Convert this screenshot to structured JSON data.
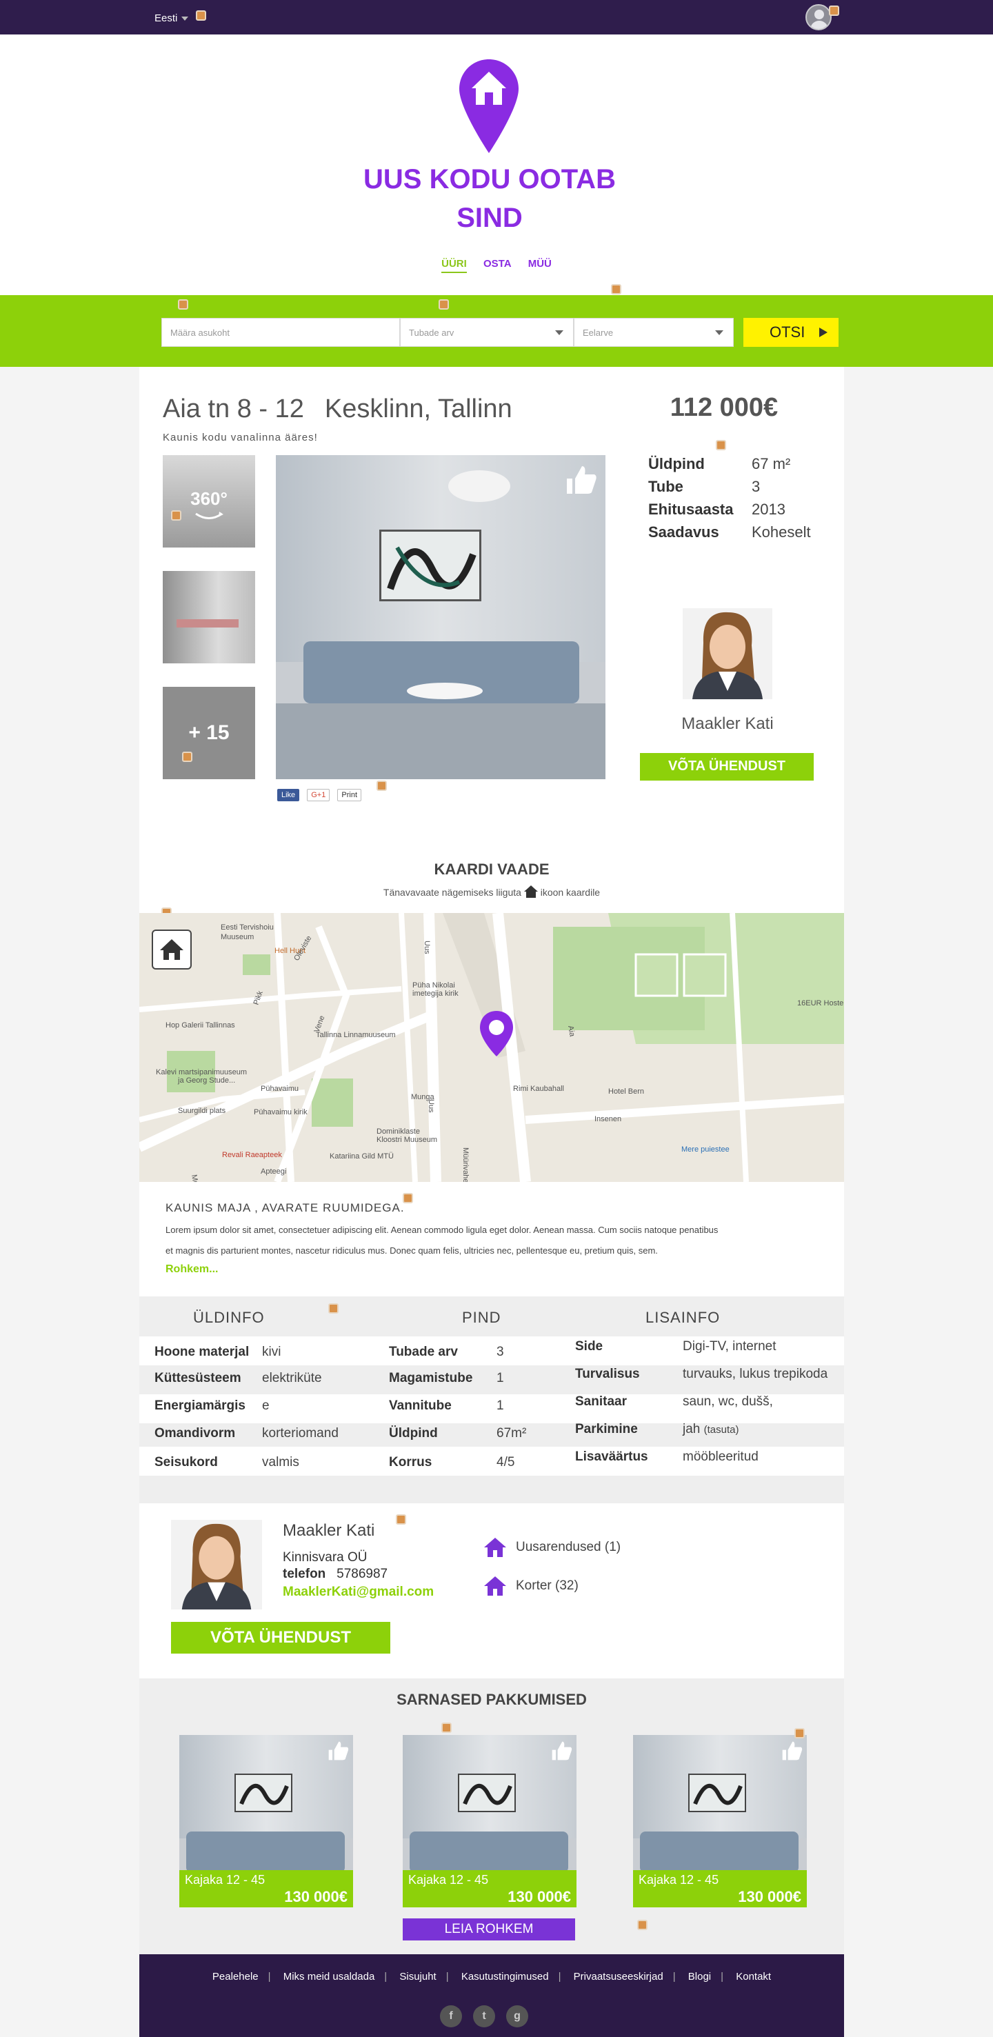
{
  "topbar": {
    "language": "Eesti"
  },
  "header": {
    "slogan_line1": "UUS KODU OOTAB",
    "slogan_line2": "SIND",
    "nav": [
      {
        "label": "ÜÜRI",
        "active": true
      },
      {
        "label": "OSTA"
      },
      {
        "label": "MÜÜ"
      }
    ]
  },
  "search": {
    "location_placeholder": "Määra asukoht",
    "rooms_placeholder": "Tubade arv",
    "budget_placeholder": "Eelarve",
    "submit_label": "OTSI"
  },
  "listing": {
    "street": "Aia tn 8 - 12",
    "district": "Kesklinn, Tallinn",
    "tagline": "Kaunis kodu vanalinna ääres!",
    "price": "112 000€",
    "thumb_360": "360°",
    "thumb_more": "+ 15",
    "social": {
      "like": "Like",
      "gplus": "G+1",
      "print": "Print"
    },
    "specs": [
      {
        "label": "Üldpind",
        "value": "67 m²"
      },
      {
        "label": "Tube",
        "value": "3"
      },
      {
        "label": "Ehitusaasta",
        "value": "2013"
      },
      {
        "label": "Saadavus",
        "value": "Koheselt"
      }
    ],
    "agent_name": "Maakler Kati",
    "contact_label": "VÕTA ÜHENDUST"
  },
  "map": {
    "title": "KAARDI VAADE",
    "subtitle_before": "Tänavavaate nägemiseks liiguta",
    "subtitle_after": "ikoon kaardile",
    "labels": {
      "museum1": "Eesti Tervishoiu",
      "museum1b": "Muuseum",
      "hellhunt": "Hell Hunt",
      "nikolai": "Püha Nikolai",
      "nikolai2": "imetegija kirik",
      "hop": "Hop Galerii Tallinnas",
      "linnamuuseum": "Tallinna Linnamuuseum",
      "kalevi": "Kalevi martsipanimuuseum",
      "kalevi2": "ja Georg Stude...",
      "suurgildi": "Suurgildi plats",
      "puhavaimu_kirik": "Pühavaimu kirik",
      "puhavaimu": "Pühavaimu",
      "munga": "Munga",
      "dominiklaste": "Dominiklaste",
      "dominiklaste2": "Kloostri Muuseum",
      "revali": "Revali Raeapteek",
      "katariina": "Katariina Gild MTÜ",
      "apteegi": "Apteegi",
      "rimi": "Rimi Kaubahall",
      "hotelbern": "Hotel Bern",
      "insenen": "Insenen",
      "mere": "Mere puiestee",
      "hostel": "16EUR Hostel",
      "viru": "Viru",
      "uus": "Uus",
      "aia": "Aia",
      "muurivahe": "Müürivahe",
      "vene": "Vene",
      "pikk": "Pikk",
      "oleviste": "Oleviste",
      "munkr": "Munk"
    }
  },
  "description": {
    "title": "KAUNIS MAJA , AVARATE RUUMIDEGA.",
    "line1": "Lorem ipsum dolor sit amet, consectetuer adipiscing elit. Aenean commodo ligula eget dolor. Aenean massa. Cum sociis natoque penatibus",
    "line2": "et magnis dis parturient montes, nascetur ridiculus mus. Donec quam felis, ultricies nec, pellentesque eu, pretium quis, sem.",
    "more_label": "Rohkem..."
  },
  "details": {
    "headers": [
      "ÜLDINFO",
      "PIND",
      "LISAINFO"
    ],
    "col1": [
      {
        "k": "Hoone materjal",
        "v": "kivi"
      },
      {
        "k": "Küttesüsteem",
        "v": "elektriküte"
      },
      {
        "k": "Energiamärgis",
        "v": "e"
      },
      {
        "k": "Omandivorm",
        "v": "korteriomand"
      },
      {
        "k": "Seisukord",
        "v": "valmis"
      }
    ],
    "col2": [
      {
        "k": "Tubade arv",
        "v": "3"
      },
      {
        "k": "Magamistube",
        "v": "1"
      },
      {
        "k": "Vannitube",
        "v": "1"
      },
      {
        "k": "Üldpind",
        "v": "67m²"
      },
      {
        "k": "Korrus",
        "v": "4/5"
      }
    ],
    "col3": [
      {
        "k": "Side",
        "v": "Digi-TV, internet"
      },
      {
        "k": "Turvalisus",
        "v": "turvauks, lukus trepikoda"
      },
      {
        "k": "Sanitaar",
        "v": "saun, wc, dušš,"
      },
      {
        "k": "Parkimine",
        "v": "jah",
        "note": "(tasuta)"
      },
      {
        "k": "Lisaväärtus",
        "v": "mööbleeritud"
      }
    ]
  },
  "agent": {
    "name": "Maakler Kati",
    "company": "Kinnisvara OÜ",
    "phone_label": "telefon",
    "phone": "5786987",
    "email": "MaaklerKati@gmail.com",
    "contact_label": "VÕTA ÜHENDUST",
    "links": [
      "Uusarendused (1)",
      "Korter (32)"
    ]
  },
  "similar": {
    "title": "SARNASED PAKKUMISED",
    "cards": [
      {
        "title": "Kajaka 12 - 45",
        "price": "130 000€"
      },
      {
        "title": "Kajaka 12 - 45",
        "price": "130 000€"
      },
      {
        "title": "Kajaka 12 - 45",
        "price": "130 000€"
      }
    ],
    "more_label": "LEIA ROHKEM"
  },
  "footer": {
    "links": [
      "Pealehele",
      "Miks meid usaldada",
      "Sisujuht",
      "Kasutustingimused",
      "Privaatsuseeskirjad",
      "Blogi",
      "Kontakt"
    ],
    "social": [
      "f",
      "t",
      "g"
    ]
  },
  "colors": {
    "purple": "#8a2be2",
    "green": "#8dd10a",
    "dark": "#2f1d4c",
    "yellow": "#fff200"
  }
}
